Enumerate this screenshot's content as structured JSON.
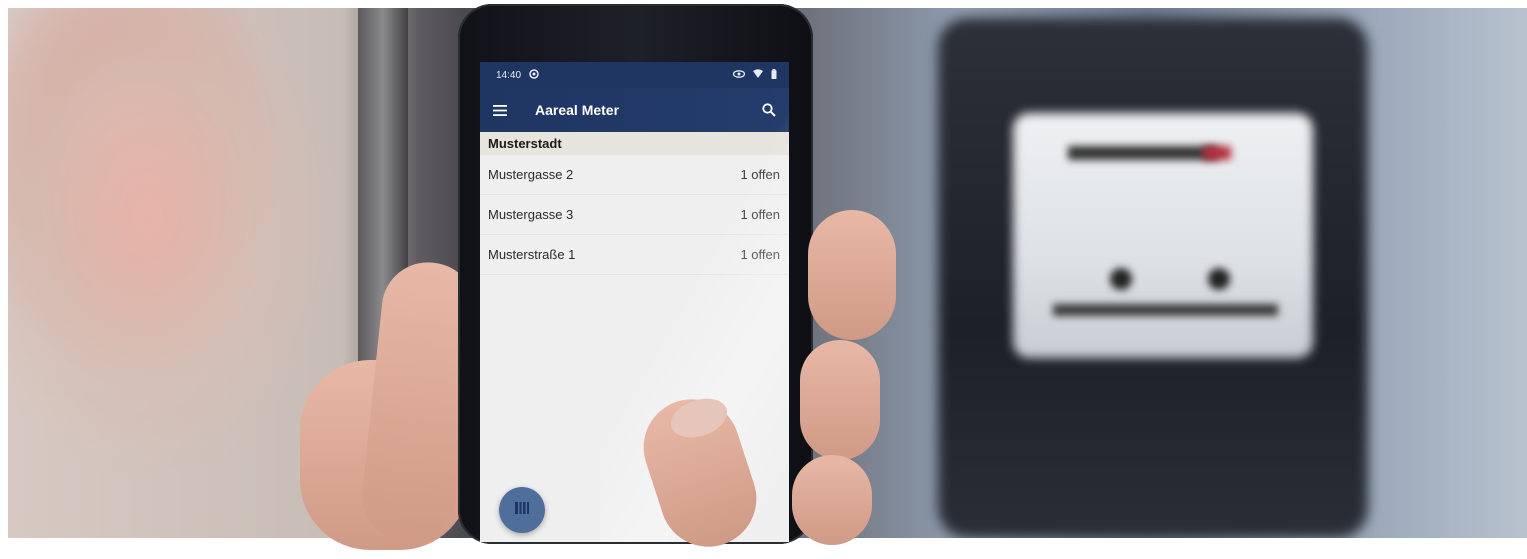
{
  "status_bar": {
    "time": "14:40",
    "left_icon": "location-icon",
    "right_icons": [
      "eye-icon",
      "wifi-icon",
      "battery-icon"
    ]
  },
  "app_bar": {
    "menu_icon": "hamburger-menu-icon",
    "title": "Aareal Meter",
    "search_icon": "search-icon"
  },
  "list": {
    "section_title": "Musterstadt",
    "items": [
      {
        "address": "Mustergasse 2",
        "status": "1 offen"
      },
      {
        "address": "Mustergasse 3",
        "status": "1 offen"
      },
      {
        "address": "Musterstraße 1",
        "status": "1 offen"
      }
    ]
  },
  "fab": {
    "icon": "barcode-scan-icon"
  },
  "colors": {
    "app_bar": "#1f3562",
    "fab": "#4f6e9c",
    "screen_bg": "#efefef"
  }
}
